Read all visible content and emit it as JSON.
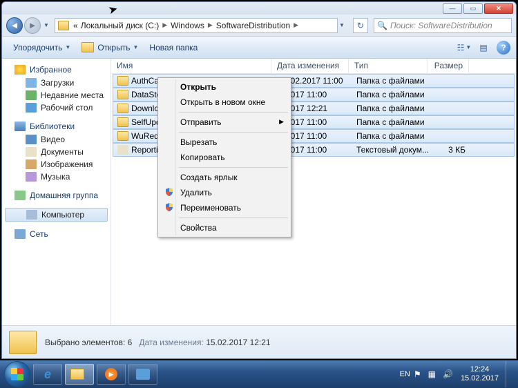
{
  "breadcrumb": {
    "p0": "«",
    "p1": "Локальный диск (C:)",
    "p2": "Windows",
    "p3": "SoftwareDistribution"
  },
  "search": {
    "placeholder": "Поиск: SoftwareDistribution"
  },
  "toolbar": {
    "organize": "Упорядочить",
    "open": "Открыть",
    "newfolder": "Новая папка"
  },
  "columns": {
    "name": "Имя",
    "date": "Дата изменения",
    "type": "Тип",
    "size": "Размер"
  },
  "sidebar": {
    "fav": "Избранное",
    "dl": "Загрузки",
    "rec": "Недавние места",
    "desk": "Рабочий стол",
    "lib": "Библиотеки",
    "vid": "Видео",
    "doc": "Документы",
    "img": "Изображения",
    "mus": "Музыка",
    "home": "Домашняя группа",
    "comp": "Компьютер",
    "net": "Сеть"
  },
  "files": [
    {
      "name": "AuthCab",
      "date": "15.02.2017 11:00",
      "type": "Папка с файлами",
      "size": "",
      "icon": "i-fold",
      "sel": true
    },
    {
      "name": "DataStore",
      "date": "2.2017 11:00",
      "type": "Папка с файлами",
      "size": "",
      "icon": "i-fold",
      "sel": true
    },
    {
      "name": "Download",
      "date": "2.2017 12:21",
      "type": "Папка с файлами",
      "size": "",
      "icon": "i-fold",
      "sel": true
    },
    {
      "name": "SelfUpdate",
      "date": "2.2017 11:00",
      "type": "Папка с файлами",
      "size": "",
      "icon": "i-fold",
      "sel": true
    },
    {
      "name": "WuRedir",
      "date": "2.2017 11:00",
      "type": "Папка с файлами",
      "size": "",
      "icon": "i-fold",
      "sel": true
    },
    {
      "name": "ReportingEvents",
      "date": "2.2017 11:00",
      "type": "Текстовый докум...",
      "size": "3 КБ",
      "icon": "i-doc",
      "sel": true
    }
  ],
  "context": {
    "open": "Открыть",
    "opennew": "Открыть в новом окне",
    "sendto": "Отправить",
    "cut": "Вырезать",
    "copy": "Копировать",
    "shortcut": "Создать ярлык",
    "delete": "Удалить",
    "rename": "Переименовать",
    "props": "Свойства"
  },
  "details": {
    "count": "Выбрано элементов: 6",
    "datelabel": "Дата изменения:",
    "date": "15.02.2017 12:21"
  },
  "tray": {
    "lang": "EN",
    "time": "12:24",
    "date": "15.02.2017"
  }
}
